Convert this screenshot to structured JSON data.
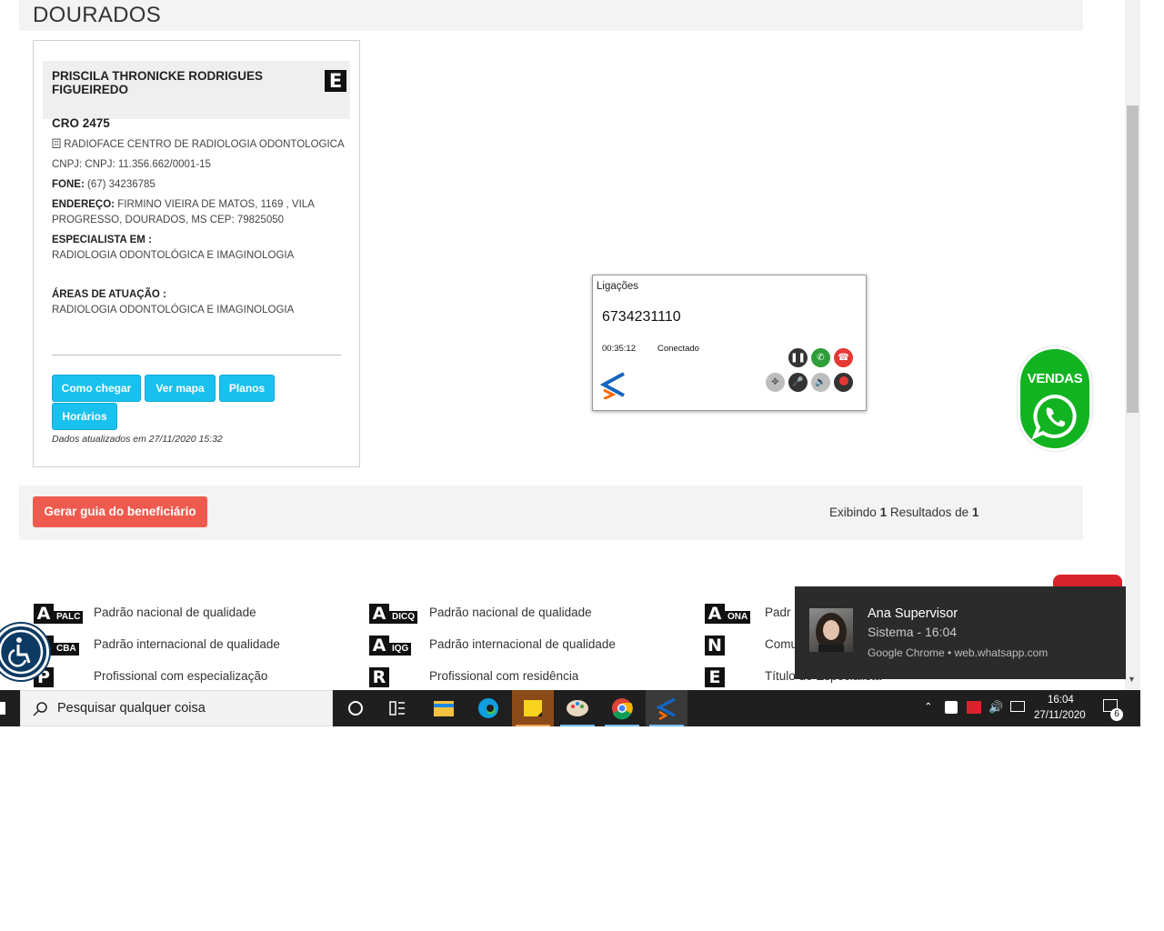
{
  "page": {
    "city": "DOURADOS",
    "dentist": {
      "name": "PRISCILA THRONICKE RODRIGUES FIGUEIREDO",
      "cro": "CRO 2475",
      "badge": "E",
      "clinic_icon": "clinic-icon",
      "clinic": "RADIOFACE CENTRO DE RADIOLOGIA ODONTOLOGICA",
      "cnpj": "CNPJ: CNPJ: 11.356.662/0001-15",
      "phone_label": "FONE:",
      "phone": "(67) 34236785",
      "address_label": "ENDEREÇO:",
      "address_line1": "FIRMINO VIEIRA DE MATOS, 1169 , VILA",
      "address_line2": "PROGRESSO, DOURADOS, MS CEP: 79825050",
      "specialist_label": "ESPECIALISTA EM :",
      "specialist": "RADIOLOGIA ODONTOLÓGICA E IMAGINOLOGIA",
      "areas_label": "ÁREAS DE ATUAÇÃO :",
      "areas": "RADIOLOGIA ODONTOLÓGICA E IMAGINOLOGIA",
      "buttons": [
        "Como chegar",
        "Ver mapa",
        "Planos",
        "Horários"
      ],
      "updated": "Dados atualizados em 27/11/2020 15:32"
    },
    "results": {
      "button": "Gerar guia do beneficiário",
      "prefix": "Exibindo",
      "count": "1",
      "middle": "Resultados de",
      "total": "1"
    },
    "legend": [
      {
        "letter": "A",
        "sub": "PALC",
        "text": "Padrão nacional de qualidade"
      },
      {
        "letter": "A",
        "sub": "CBA",
        "text": "Padrão internacional de qualidade"
      },
      {
        "letter": "P",
        "sub": "",
        "text": "Profissional com especialização"
      },
      {
        "letter": "A",
        "sub": "DICQ",
        "text": "Padrão nacional de qualidade"
      },
      {
        "letter": "A",
        "sub": "IQG",
        "text": "Padrão internacional de qualidade"
      },
      {
        "letter": "R",
        "sub": "",
        "text": "Profissional com residência"
      },
      {
        "letter": "A",
        "sub": "ONA",
        "text": "Padr"
      },
      {
        "letter": "N",
        "sub": "",
        "text": "Comu"
      },
      {
        "letter": "E",
        "sub": "",
        "text": "Título de Especialista"
      }
    ],
    "vendas": "VENDAS"
  },
  "call_widget": {
    "title": "Ligações",
    "number": "6734231110",
    "duration": "00:35:12",
    "status": "Conectado",
    "icons": [
      "pause-icon",
      "answer-call-icon",
      "hangup-icon",
      "transfer-icon",
      "mute-icon",
      "volume-icon",
      "record-icon"
    ],
    "colors": {
      "pause": "#333333",
      "answer": "#2e9e3a",
      "hangup": "#e53935",
      "gray": "#bdbdbd",
      "record": "#d32f2f"
    }
  },
  "notification": {
    "title": "Ana Supervisor",
    "subtitle": "Sistema - 16:04",
    "source": "Google Chrome • web.whatsapp.com"
  },
  "taskbar": {
    "search_placeholder": "Pesquisar qualquer coisa",
    "time": "16:04",
    "date": "27/11/2020",
    "notification_count": "6"
  }
}
